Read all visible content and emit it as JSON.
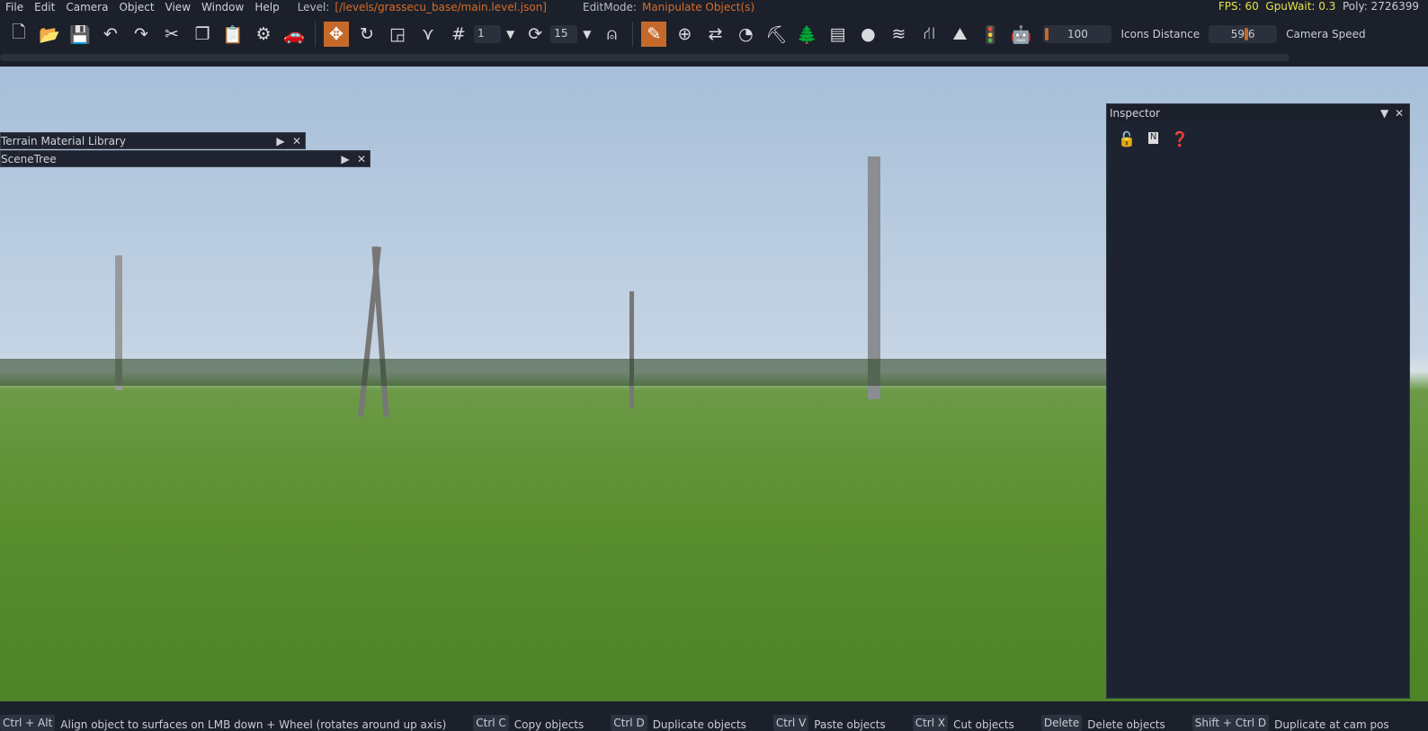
{
  "menu": [
    "File",
    "Edit",
    "Camera",
    "Object",
    "View",
    "Window",
    "Help"
  ],
  "level_label": "Level:",
  "level_path": "[/levels/grassecu_base/main.level.json]",
  "editmode_label": "EditMode:",
  "editmode_value": "Manipulate Object(s)",
  "stats": {
    "fps": "FPS: 60",
    "gpuwait": "GpuWait: 0.3",
    "poly": "Poly: 2726399"
  },
  "toolbar": {
    "snap_value": "1",
    "rot_snap_value": "15",
    "field1_value": "100",
    "icons_distance_label": "Icons Distance",
    "icons_distance_value": "59.6",
    "camera_speed_label": "Camera Speed"
  },
  "windows": {
    "terrain": "Terrain Material Library",
    "scenetree": "SceneTree",
    "inspector": "Inspector"
  },
  "status": [
    {
      "key": "Ctrl + Alt",
      "desc": "Align object to surfaces on LMB down + Wheel (rotates around up axis)"
    },
    {
      "key": "Ctrl C",
      "desc": "Copy objects"
    },
    {
      "key": "Ctrl D",
      "desc": "Duplicate objects"
    },
    {
      "key": "Ctrl V",
      "desc": "Paste objects"
    },
    {
      "key": "Ctrl X",
      "desc": "Cut objects"
    },
    {
      "key": "Delete",
      "desc": "Delete objects"
    },
    {
      "key": "Shift + Ctrl D",
      "desc": "Duplicate at cam pos"
    }
  ]
}
